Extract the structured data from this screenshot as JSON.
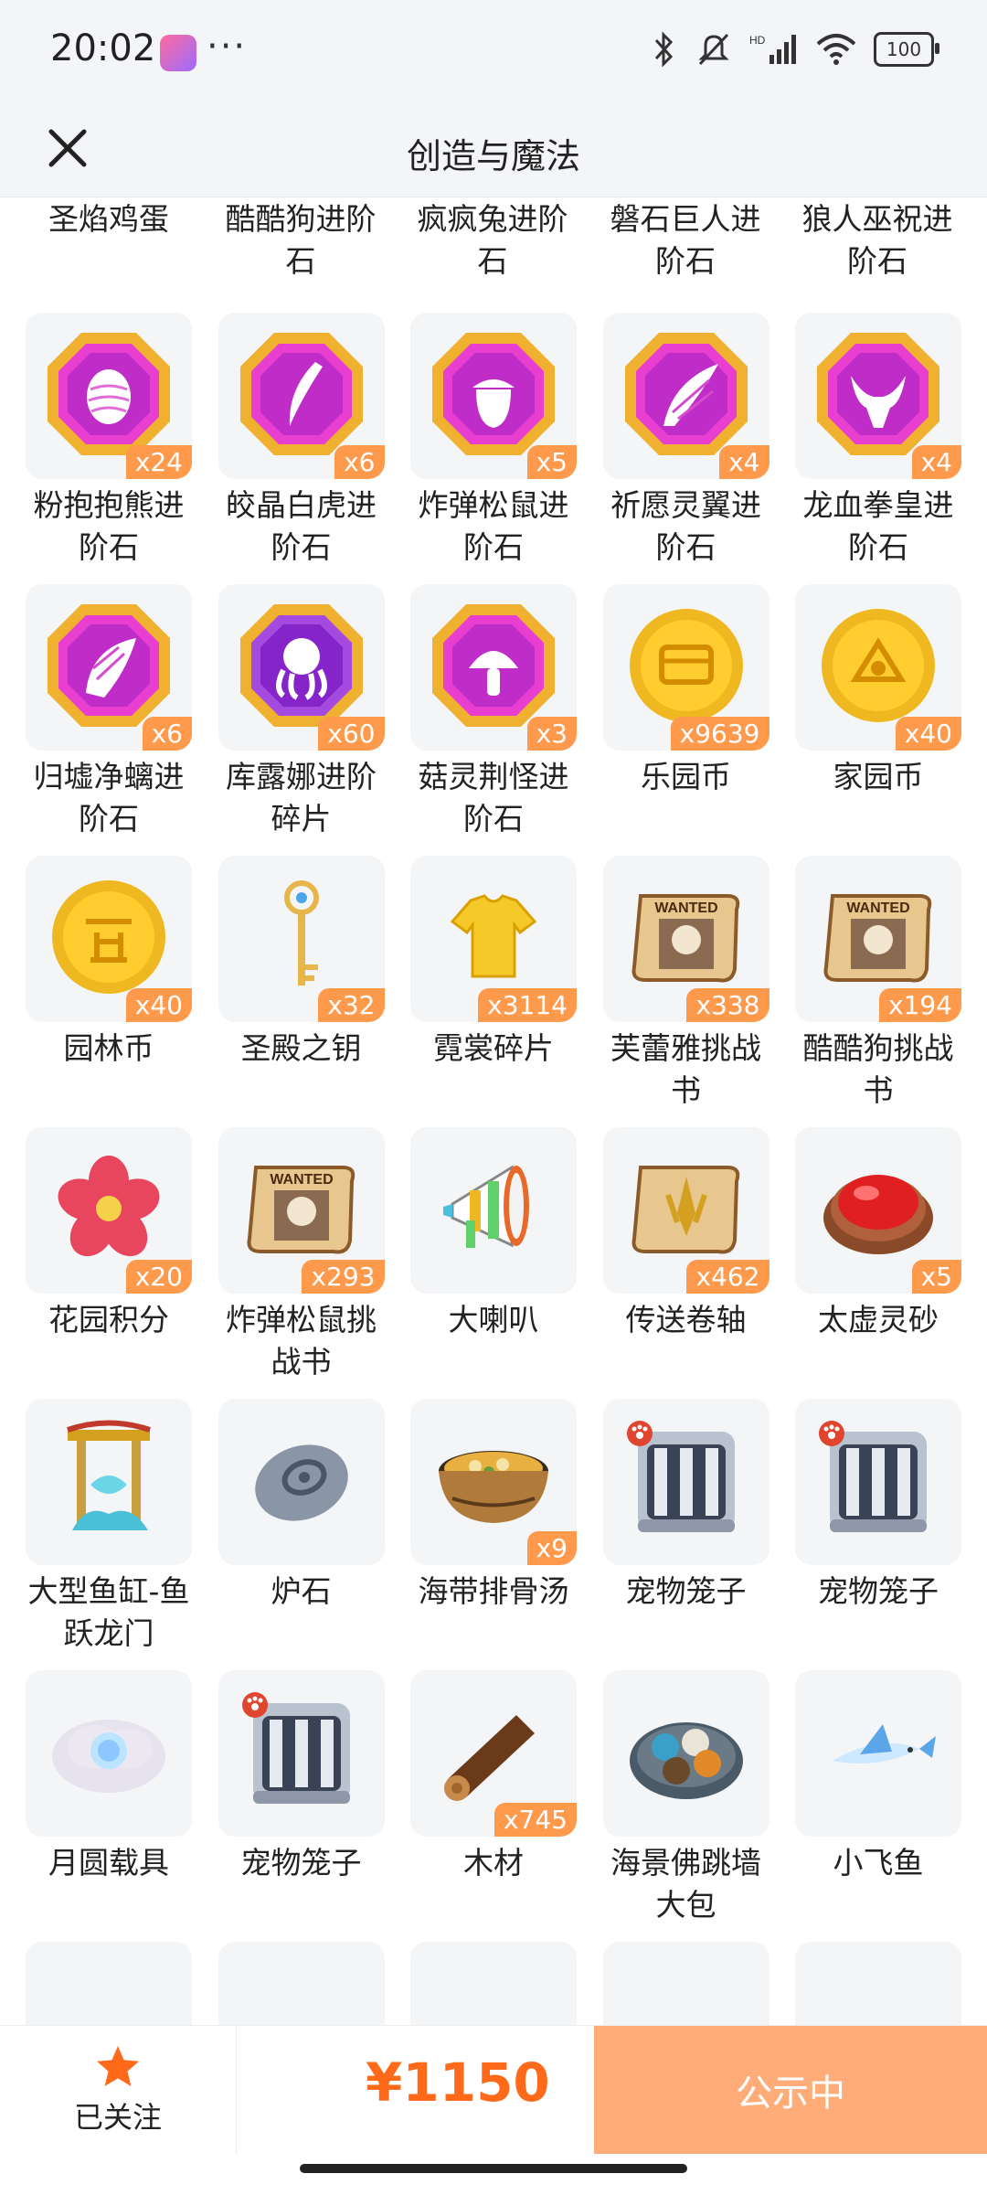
{
  "status_bar": {
    "time": "20:02",
    "dots": "···",
    "battery": "100"
  },
  "header": {
    "title": "创造与魔法"
  },
  "top_row": [
    "圣焰鸡蛋",
    "酷酷狗进阶石",
    "疯疯兔进阶石",
    "磐石巨人进阶石",
    "狼人巫祝进阶石"
  ],
  "items": [
    {
      "label": "粉抱抱熊进阶石",
      "qty": "x24",
      "icon": "egg-gem-icon"
    },
    {
      "label": "皎晶白虎进阶石",
      "qty": "x6",
      "icon": "fang-gem-icon"
    },
    {
      "label": "炸弹松鼠进阶石",
      "qty": "x5",
      "icon": "acorn-gem-icon"
    },
    {
      "label": "祈愿灵翼进阶石",
      "qty": "x4",
      "icon": "wing-gem-icon"
    },
    {
      "label": "龙血拳皇进阶石",
      "qty": "x4",
      "icon": "horns-gem-icon"
    },
    {
      "label": "归墟净螭进阶石",
      "qty": "x6",
      "icon": "scale-gem-icon"
    },
    {
      "label": "库露娜进阶碎片",
      "qty": "x60",
      "icon": "octopus-gem-icon"
    },
    {
      "label": "菇灵荆怪进阶石",
      "qty": "x3",
      "icon": "mushroom-gem-icon"
    },
    {
      "label": "乐园币",
      "qty": "x9639",
      "icon": "park-coin-icon"
    },
    {
      "label": "家园币",
      "qty": "x40",
      "icon": "home-coin-icon"
    },
    {
      "label": "园林币",
      "qty": "x40",
      "icon": "garden-coin-icon"
    },
    {
      "label": "圣殿之钥",
      "qty": "x32",
      "icon": "key-icon"
    },
    {
      "label": "霓裳碎片",
      "qty": "x3114",
      "icon": "shirt-icon"
    },
    {
      "label": "芙蕾雅挑战书",
      "qty": "x338",
      "icon": "wanted-scroll-icon"
    },
    {
      "label": "酷酷狗挑战书",
      "qty": "x194",
      "icon": "wanted-scroll-icon"
    },
    {
      "label": "花园积分",
      "qty": "x20",
      "icon": "flower-icon"
    },
    {
      "label": "炸弹松鼠挑战书",
      "qty": "x293",
      "icon": "wanted-scroll-icon"
    },
    {
      "label": "大喇叭",
      "qty": "",
      "icon": "megaphone-icon"
    },
    {
      "label": "传送卷轴",
      "qty": "x462",
      "icon": "teleport-scroll-icon"
    },
    {
      "label": "太虚灵砂",
      "qty": "x5",
      "icon": "red-sand-icon"
    },
    {
      "label": "大型鱼缸-鱼跃龙门",
      "qty": "",
      "icon": "aquarium-icon"
    },
    {
      "label": "炉石",
      "qty": "",
      "icon": "hearthstone-icon"
    },
    {
      "label": "海带排骨汤",
      "qty": "x9",
      "icon": "soup-icon"
    },
    {
      "label": "宠物笼子",
      "qty": "",
      "icon": "pet-cage-icon"
    },
    {
      "label": "宠物笼子",
      "qty": "",
      "icon": "pet-cage-icon"
    },
    {
      "label": "月圆载具",
      "qty": "",
      "icon": "moon-vehicle-icon"
    },
    {
      "label": "宠物笼子",
      "qty": "",
      "icon": "pet-cage-icon"
    },
    {
      "label": "木材",
      "qty": "x745",
      "icon": "wood-icon"
    },
    {
      "label": "海景佛跳墙大包",
      "qty": "",
      "icon": "dumplings-icon"
    },
    {
      "label": "小飞鱼",
      "qty": "",
      "icon": "flying-fish-icon"
    }
  ],
  "bottom_bar": {
    "follow_label": "已关注",
    "price": "¥1150",
    "cta_label": "公示中"
  },
  "colors": {
    "accent": "#ff6a1a",
    "cta": "#ffac78",
    "qty_badge": "#ff9a4d"
  }
}
